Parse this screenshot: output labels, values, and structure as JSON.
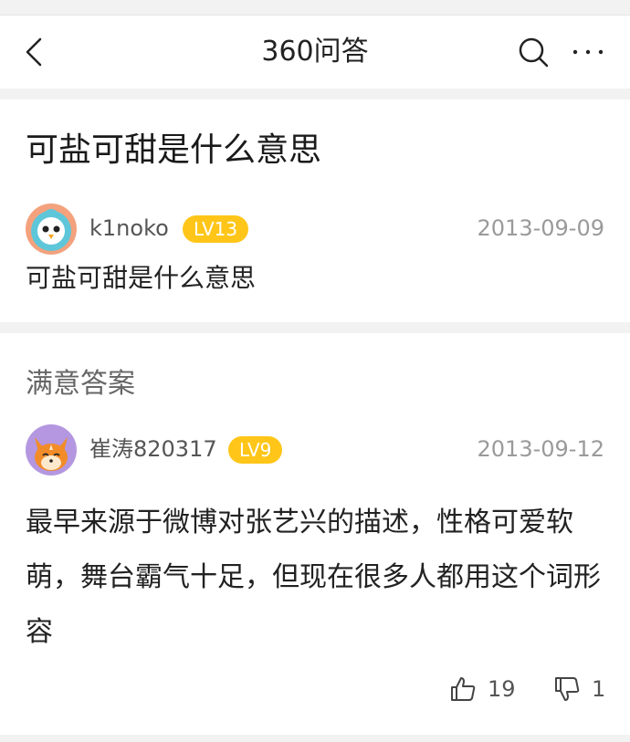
{
  "header": {
    "title": "360问答"
  },
  "question": {
    "title": "可盐可甜是什么意思",
    "user": {
      "name": "k1noko",
      "level": "LV13"
    },
    "date": "2013-09-09",
    "body": "可盐可甜是什么意思"
  },
  "answer": {
    "section_label": "满意答案",
    "user": {
      "name": "崔涛820317",
      "level": "LV9"
    },
    "date": "2013-09-12",
    "body": "最早来源于微博对张艺兴的描述，性格可爱软萌，舞台霸气十足，但现在很多人都用这个词形容",
    "likes": "19",
    "dislikes": "1"
  },
  "icons": {
    "back": "chevron-left-icon",
    "search": "search-icon",
    "more": "more-icon",
    "like": "thumbs-up-icon",
    "dislike": "thumbs-down-icon"
  },
  "colors": {
    "level_badge": "#ffc619"
  }
}
